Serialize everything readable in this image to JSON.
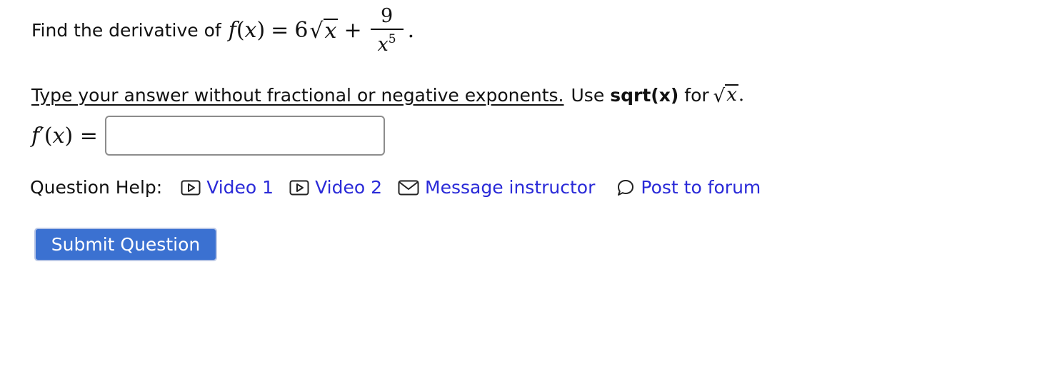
{
  "problem": {
    "lead": "Find the derivative of",
    "func": "f",
    "var": "x",
    "coef": "6",
    "numerator": "9",
    "exponent": "5"
  },
  "instruction": {
    "underlined": "Type your answer without fractional or negative exponents.",
    "use": "Use",
    "code": "sqrt(x)",
    "for": "for"
  },
  "answer": {
    "lhs_func": "f",
    "value": ""
  },
  "help": {
    "label": "Question Help:",
    "video1": "Video 1",
    "video2": "Video 2",
    "message": "Message instructor",
    "forum": "Post to forum",
    "link_color": "#2a2ad8"
  },
  "submit": {
    "label": "Submit Question",
    "color": "#3b71d1"
  }
}
